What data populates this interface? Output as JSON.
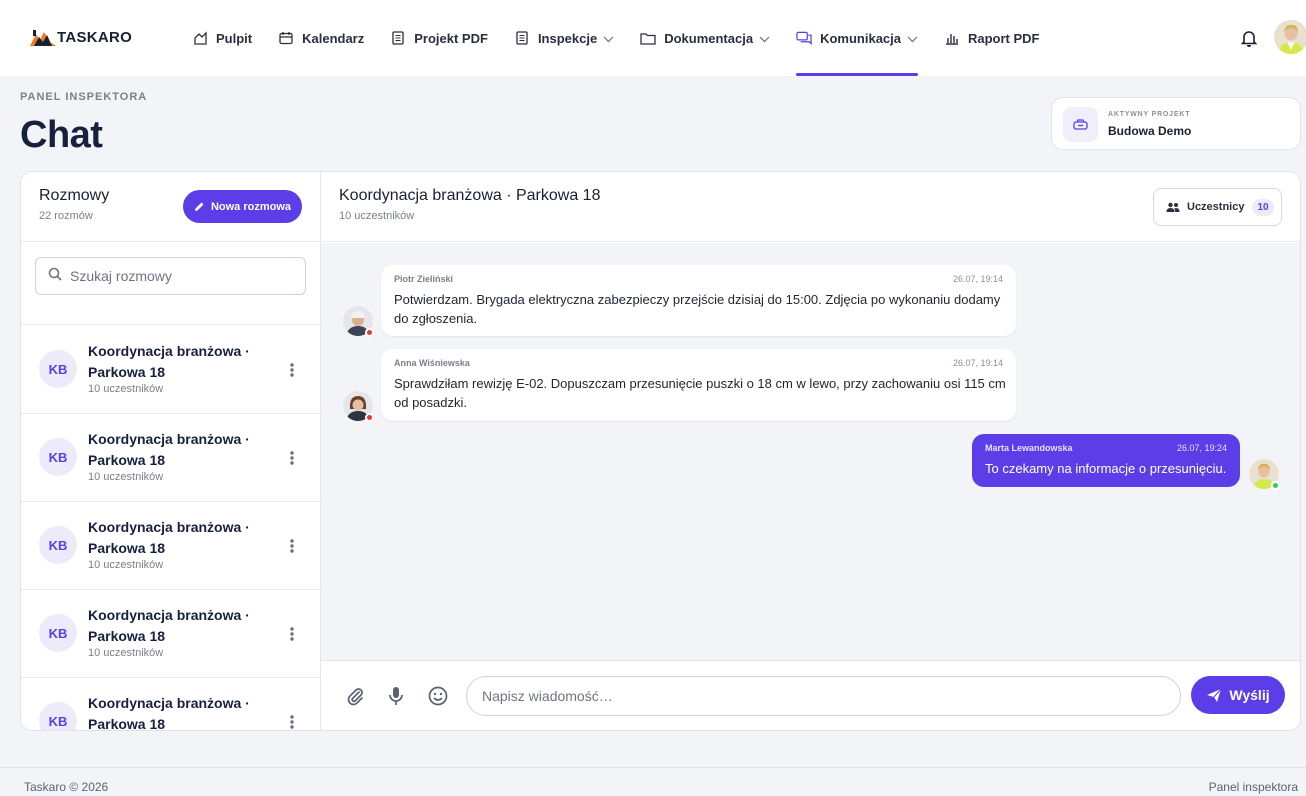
{
  "brand": {
    "name": "TASKARO",
    "accent": "#5b3ee8",
    "logo_orange": "#f07b1e"
  },
  "nav": {
    "items": [
      {
        "label": "Pulpit",
        "icon": "dashboard-icon",
        "dropdown": false,
        "active": false
      },
      {
        "label": "Kalendarz",
        "icon": "calendar-icon",
        "dropdown": false,
        "active": false
      },
      {
        "label": "Projekt PDF",
        "icon": "document-icon",
        "dropdown": false,
        "active": false
      },
      {
        "label": "Inspekcje",
        "icon": "clipboard-icon",
        "dropdown": true,
        "active": false
      },
      {
        "label": "Dokumentacja",
        "icon": "folder-icon",
        "dropdown": true,
        "active": false
      },
      {
        "label": "Komunikacja",
        "icon": "chat-icon",
        "dropdown": true,
        "active": true
      },
      {
        "label": "Raport PDF",
        "icon": "bar-chart-icon",
        "dropdown": false,
        "active": false
      }
    ]
  },
  "header": {
    "eyebrow": "PANEL INSPEKTORA",
    "title": "Chat",
    "project_eyebrow": "AKTYWNY PROJEKT",
    "project_name": "Budowa Demo"
  },
  "conversations": {
    "title": "Rozmowy",
    "count": "22 rozmów",
    "new_button": "Nowa rozmowa",
    "search_placeholder": "Szukaj rozmowy",
    "items": [
      {
        "initials": "KB",
        "title": "Koordynacja branżowa · Parkowa 18",
        "subtitle": "10 uczestników"
      },
      {
        "initials": "KB",
        "title": "Koordynacja branżowa · Parkowa 18",
        "subtitle": "10 uczestników"
      },
      {
        "initials": "KB",
        "title": "Koordynacja branżowa · Parkowa 18",
        "subtitle": "10 uczestników"
      },
      {
        "initials": "KB",
        "title": "Koordynacja branżowa · Parkowa 18",
        "subtitle": "10 uczestników"
      },
      {
        "initials": "KB",
        "title": "Koordynacja branżowa · Parkowa 18",
        "subtitle": ""
      }
    ]
  },
  "chat": {
    "title": "Koordynacja branżowa · Parkowa 18",
    "subtitle": "10 uczestników",
    "participants_label": "Uczestnicy",
    "participants_count": "10",
    "messages": [
      {
        "author": "Piotr Zieliński",
        "time": "26.07, 19:14",
        "text_lines": [
          "Potwierdzam. Brygada elektryczna zabezpieczy przejście dzisiaj do 15:00. Zdjęcia po wykonaniu dodamy",
          "do zgłoszenia."
        ],
        "own": false,
        "status_color": "#e53935"
      },
      {
        "author": "Anna Wiśniewska",
        "time": "26.07, 19:14",
        "text_lines": [
          "Sprawdziłam rewizję E-02. Dopuszczam przesunięcie puszki o 18 cm w lewo, przy zachowaniu osi 115 cm",
          "od posadzki."
        ],
        "own": false,
        "status_color": "#e53935"
      },
      {
        "author": "Marta Lewandowska",
        "time": "26.07, 19:24",
        "text_lines": [
          "To czekamy na informacje o przesunięciu."
        ],
        "own": true,
        "status_color": "#2ecc71"
      }
    ],
    "composer_placeholder": "Napisz wiadomość…",
    "send_label": "Wyślij"
  },
  "footer": {
    "left": "Taskaro © 2026",
    "right": "Panel inspektora"
  }
}
